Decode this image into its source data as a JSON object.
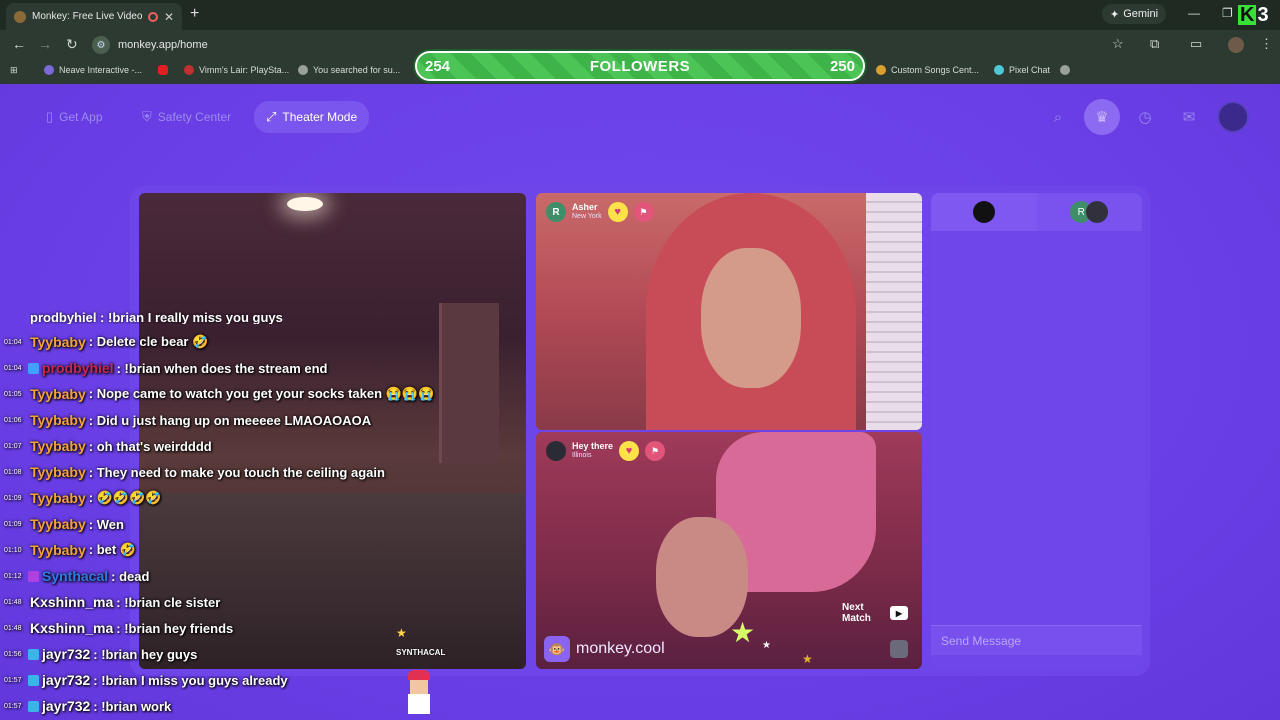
{
  "browser": {
    "tab_title": "Monkey: Free Live Video Ch",
    "new_tab": "+",
    "gemini_label": "Gemini",
    "url": "monkey.app/home",
    "bookmarks": [
      {
        "label": "Neave Interactive -..."
      },
      {
        "label": "Vimm's Lair: PlaySta..."
      },
      {
        "label": "You searched for su..."
      },
      {
        "label": "Custom Songs Cent..."
      },
      {
        "label": "Pixel Chat"
      }
    ]
  },
  "overlay": {
    "followers_left": "254",
    "followers_label": "FOLLOWERS",
    "followers_right": "250",
    "k_logo": "K",
    "k_logo_num": "3"
  },
  "topnav": {
    "get_app": "Get App",
    "safety_center": "Safety Center",
    "theater_mode": "Theater Mode"
  },
  "video_top": {
    "avatar_letter": "R",
    "name": "Asher",
    "location": "New York"
  },
  "video_bottom": {
    "name": "Hey there",
    "location": "Illinois",
    "next_match": "Next Match",
    "watermark": "monkey.cool"
  },
  "chat_panel": {
    "tab2_letter": "R",
    "send_placeholder": "Send Message"
  },
  "stream_chat": {
    "partial_line": "prodbyhiel : !brian I really miss you guys",
    "sprite_label": "SYNTHACAL",
    "lines": [
      {
        "time": "01:04",
        "name": "Tyybaby",
        "msg": ": Delete cle bear 🤣",
        "color": "#f6a23a",
        "badge": ""
      },
      {
        "time": "01:04",
        "name": "prodbyhiel",
        "msg": ": !brian when does the stream end",
        "color": "#c5284a",
        "badge": "#3fa0ff"
      },
      {
        "time": "01:05",
        "name": "Tyybaby",
        "msg": ": Nope came to watch you get your socks taken 😭😭😭",
        "color": "#f6a23a",
        "badge": ""
      },
      {
        "time": "01:06",
        "name": "Tyybaby",
        "msg": ": Did u just hang up on meeeee LMAOAOAOA",
        "color": "#f6a23a",
        "badge": ""
      },
      {
        "time": "01:07",
        "name": "Tyybaby",
        "msg": ": oh that's weirdddd",
        "color": "#f6a23a",
        "badge": ""
      },
      {
        "time": "01:08",
        "name": "Tyybaby",
        "msg": ": They need to make you touch the ceiling again",
        "color": "#f6a23a",
        "badge": ""
      },
      {
        "time": "01:09",
        "name": "Tyybaby",
        "msg": ": 🤣🤣🤣🤣",
        "color": "#f6a23a",
        "badge": ""
      },
      {
        "time": "01:09",
        "name": "Tyybaby",
        "msg": ": Wen",
        "color": "#f6a23a",
        "badge": ""
      },
      {
        "time": "01:10",
        "name": "Tyybaby",
        "msg": ": bet 🤣",
        "color": "#f6a23a",
        "badge": ""
      },
      {
        "time": "01:12",
        "name": "Synthacal",
        "msg": ": dead",
        "color": "#2f7ce0",
        "badge": "#b040e0"
      },
      {
        "time": "01:48",
        "name": "Kxshinn_ma",
        "msg": ": !brian cle sister",
        "color": "#ffffff",
        "badge": ""
      },
      {
        "time": "01:48",
        "name": "Kxshinn_ma",
        "msg": ": !brian hey friends",
        "color": "#ffffff",
        "badge": ""
      },
      {
        "time": "01:56",
        "name": "jayr732",
        "msg": ": !brian hey guys",
        "color": "#ffffff",
        "badge": "#38b6e8"
      },
      {
        "time": "01:57",
        "name": "jayr732",
        "msg": ": !brian I miss you guys already",
        "color": "#ffffff",
        "badge": "#38b6e8"
      },
      {
        "time": "01:57",
        "name": "jayr732",
        "msg": ": !brian work",
        "color": "#ffffff",
        "badge": "#38b6e8"
      }
    ]
  },
  "colors": {
    "app_bg": "#6a3fe6",
    "accent": "#7a55ee",
    "followers_bar": "#4cc456"
  }
}
